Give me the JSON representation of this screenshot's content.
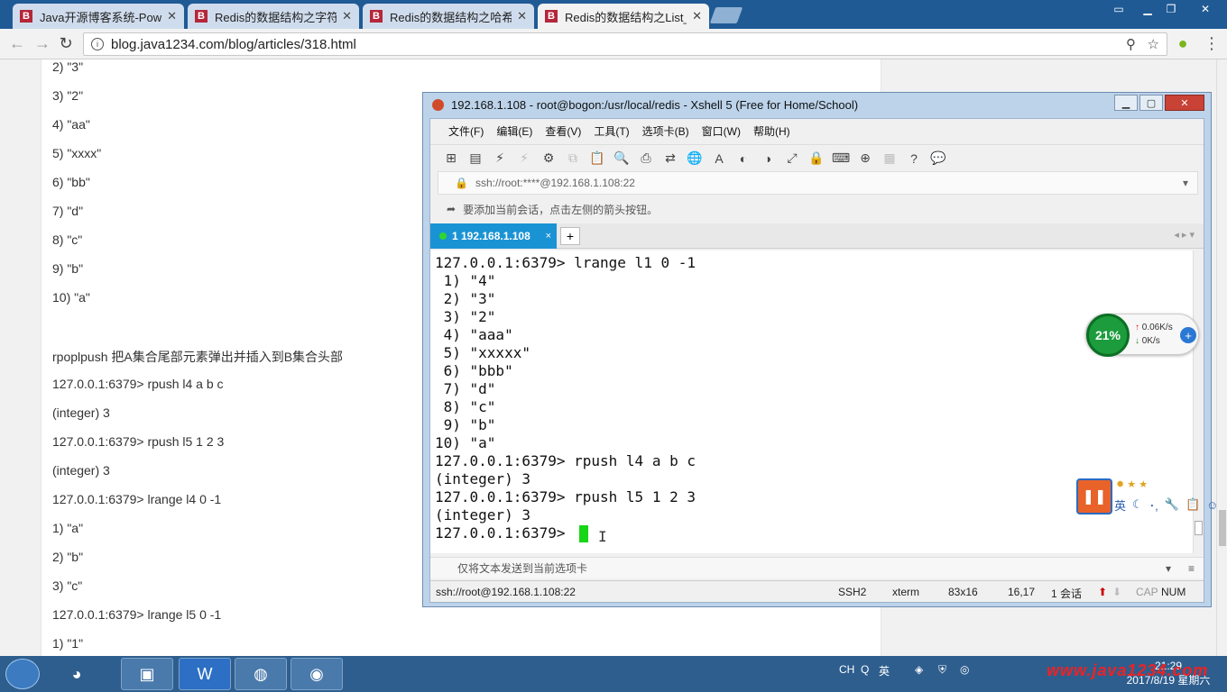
{
  "browser": {
    "tabs": [
      {
        "label": "Java开源博客系统-Powe",
        "active": false
      },
      {
        "label": "Redis的数据结构之字符",
        "active": false
      },
      {
        "label": "Redis的数据结构之哈希",
        "active": false
      },
      {
        "label": "Redis的数据结构之List_",
        "active": true
      }
    ],
    "tab_icon_letter": "B",
    "close_glyph": "✕",
    "url": "blog.java1234.com/blog/articles/318.html"
  },
  "article": {
    "lines": [
      " 2) \"3\"",
      " 3) \"2\"",
      " 4) \"aa\"",
      " 5) \"xxxx\"",
      " 6) \"bb\"",
      " 7) \"d\"",
      " 8) \"c\"",
      " 9) \"b\"",
      "10) \"a\"",
      "",
      "rpoplpush 把A集合尾部元素弹出并插入到B集合头部",
      "127.0.0.1:6379> rpush l4 a b c",
      "(integer) 3",
      "127.0.0.1:6379> rpush l5 1 2 3",
      "(integer) 3",
      "127.0.0.1:6379> lrange l4 0 -1",
      "1) \"a\"",
      "2) \"b\"",
      "3) \"c\"",
      "127.0.0.1:6379> lrange l5 0 -1",
      "1) \"1\""
    ]
  },
  "xshell": {
    "title": "192.168.1.108 - root@bogon:/usr/local/redis - Xshell 5 (Free for Home/School)",
    "menu": [
      "文件(F)",
      "编辑(E)",
      "查看(V)",
      "工具(T)",
      "选项卡(B)",
      "窗口(W)",
      "帮助(H)"
    ],
    "address": "ssh://root:****@192.168.1.108:22",
    "hint": "要添加当前会话，点击左侧的箭头按钮。",
    "session_tab": "1 192.168.1.108",
    "add_tab": "+",
    "terminal_lines": [
      "127.0.0.1:6379> lrange l1 0 -1",
      " 1) \"4\"",
      " 2) \"3\"",
      " 3) \"2\"",
      " 4) \"aaa\"",
      " 5) \"xxxxx\"",
      " 6) \"bbb\"",
      " 7) \"d\"",
      " 8) \"c\"",
      " 9) \"b\"",
      "10) \"a\"",
      "127.0.0.1:6379> rpush l4 a b c",
      "(integer) 3",
      "127.0.0.1:6379> rpush l5 1 2 3",
      "(integer) 3",
      "127.0.0.1:6379> "
    ],
    "send_bar": "仅将文本发送到当前选项卡",
    "status": {
      "connection": "ssh://root@192.168.1.108:22",
      "protocol": "SSH2",
      "terminal": "xterm",
      "size": "83x16",
      "cursor_pos": "16,17",
      "sessions": "1 会话",
      "cap": "CAP",
      "num": "NUM"
    }
  },
  "net_widget": {
    "percent": "21%",
    "up": "0.06K/s",
    "down": "0K/s"
  },
  "ime": {
    "lang": "英"
  },
  "taskbar": {
    "tray_lang": "CH",
    "tray_ime": "英",
    "time": "21:29",
    "date": "2017/8/19 星期六"
  },
  "watermark": "www.java1234.com",
  "colors": {
    "accent_tab": "#1a93d4",
    "cursor": "#16d616",
    "brand_icon": "#b5263a"
  }
}
